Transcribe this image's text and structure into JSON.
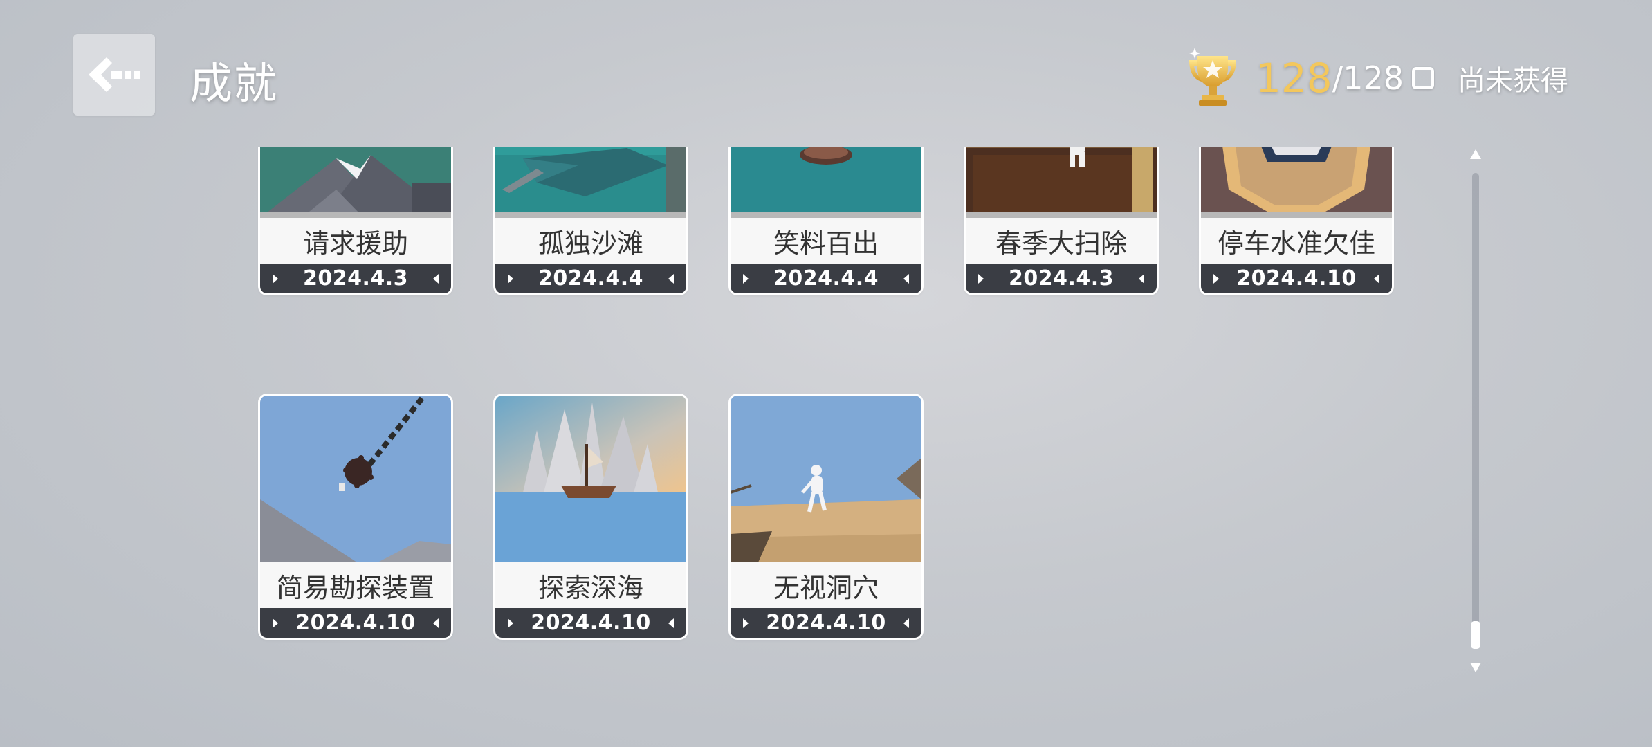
{
  "header": {
    "title": "成就",
    "back_icon": "back-arrow-icon"
  },
  "progress": {
    "icon": "trophy-icon",
    "current": "128",
    "separator": "/",
    "total": "128",
    "filter_label": "尚未获得"
  },
  "colors": {
    "accent_gold": "#f3c75c",
    "date_bar": "#3a3d44",
    "text_white": "#ffffff"
  },
  "achievements": [
    {
      "name": "请求援助",
      "date": "2024.4.3",
      "scene": "mountain"
    },
    {
      "name": "孤独沙滩",
      "date": "2024.4.4",
      "scene": "teal-boat"
    },
    {
      "name": "笑料百出",
      "date": "2024.4.4",
      "scene": "teal-water"
    },
    {
      "name": "春季大扫除",
      "date": "2024.4.3",
      "scene": "brown-room"
    },
    {
      "name": "停车水准欠佳",
      "date": "2024.4.10",
      "scene": "octagon-wood"
    },
    {
      "name": "简易勘探装置",
      "date": "2024.4.10",
      "scene": "wrecking-ball"
    },
    {
      "name": "探索深海",
      "date": "2024.4.10",
      "scene": "pirate-ship"
    },
    {
      "name": "无视洞穴",
      "date": "2024.4.10",
      "scene": "desert-walker"
    }
  ]
}
